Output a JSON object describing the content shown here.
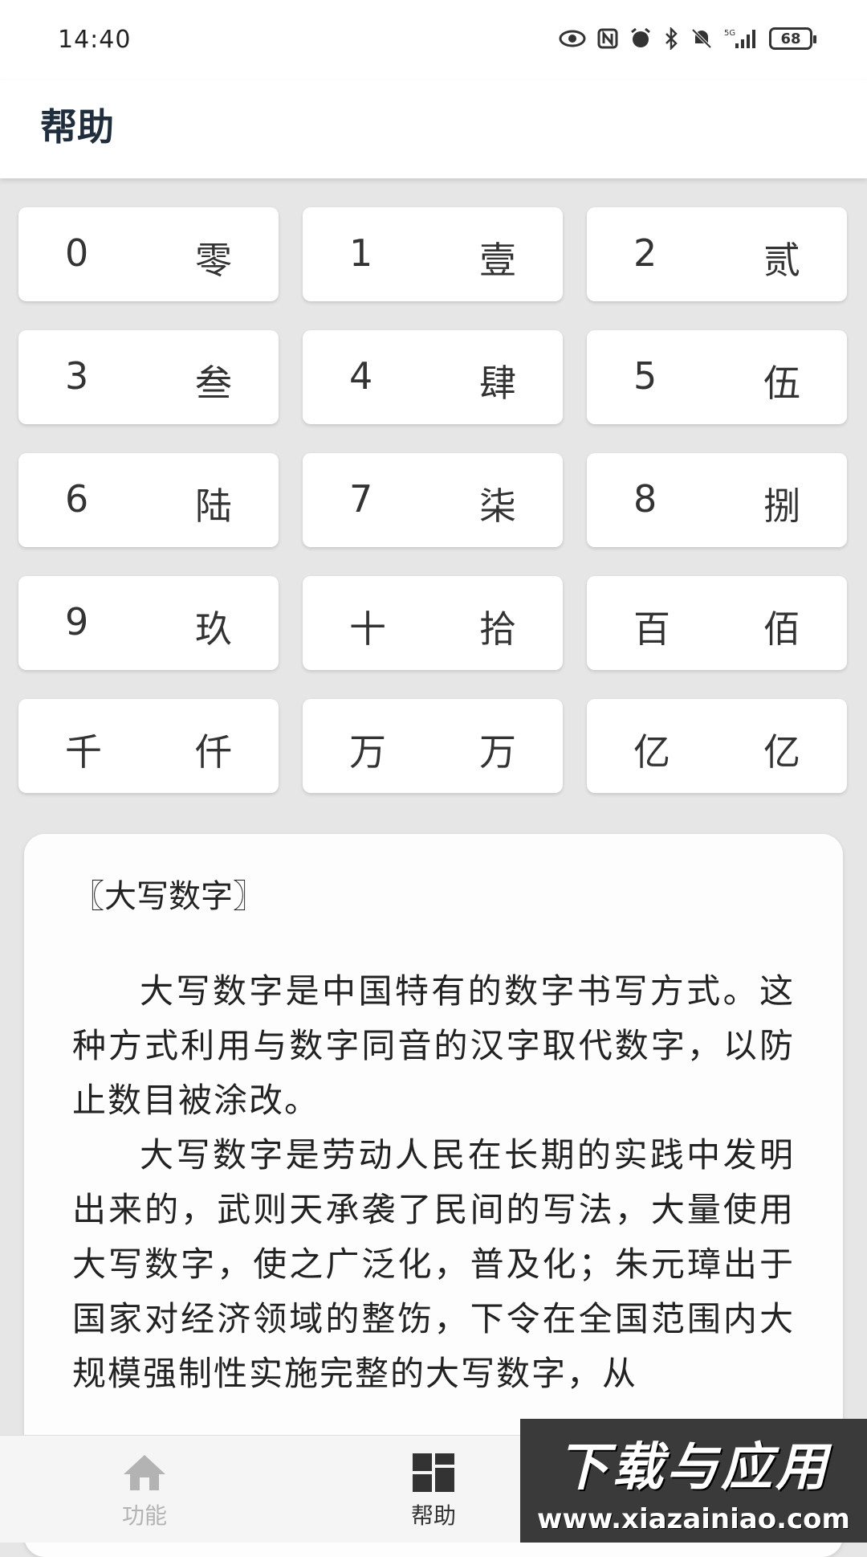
{
  "status_bar": {
    "time": "14:40",
    "icons": [
      "eye-icon",
      "nfc-icon",
      "alarm-icon",
      "bluetooth-icon",
      "mute-icon",
      "signal-5g-icon"
    ],
    "battery": "68"
  },
  "app_bar": {
    "title": "帮助"
  },
  "numerals": [
    {
      "digit": "0",
      "upper": "零"
    },
    {
      "digit": "1",
      "upper": "壹"
    },
    {
      "digit": "2",
      "upper": "贰"
    },
    {
      "digit": "3",
      "upper": "叁"
    },
    {
      "digit": "4",
      "upper": "肆"
    },
    {
      "digit": "5",
      "upper": "伍"
    },
    {
      "digit": "6",
      "upper": "陆"
    },
    {
      "digit": "7",
      "upper": "柒"
    },
    {
      "digit": "8",
      "upper": "捌"
    },
    {
      "digit": "9",
      "upper": "玖"
    },
    {
      "digit": "十",
      "upper": "拾"
    },
    {
      "digit": "百",
      "upper": "佰"
    },
    {
      "digit": "千",
      "upper": "仟"
    },
    {
      "digit": "万",
      "upper": "万"
    },
    {
      "digit": "亿",
      "upper": "亿"
    }
  ],
  "article": {
    "title": "〖大写数字〗",
    "paragraphs": [
      "大写数字是中国特有的数字书写方式。这种方式利用与数字同音的汉字取代数字，以防止数目被涂改。",
      "大写数字是劳动人民在长期的实践中发明出来的，武则天承袭了民间的写法，大量使用大写数字，使之广泛化，普及化；朱元璋出于国家对经济领域的整饬，下令在全国范围内大规模强制性实施完整的大写数字，从"
    ]
  },
  "bottom_nav": {
    "items": [
      {
        "label": "功能",
        "icon": "home-icon",
        "active": false
      },
      {
        "label": "帮助",
        "icon": "dashboard-icon",
        "active": true
      }
    ]
  },
  "watermark": {
    "title": "下载与应用",
    "url": "www.xiazainiao.com"
  },
  "colors": {
    "background": "#e6e6e6",
    "card": "#ffffff",
    "title": "#1f2d3d",
    "nav_active": "#333333",
    "nav_inactive": "#b3b3b3"
  }
}
